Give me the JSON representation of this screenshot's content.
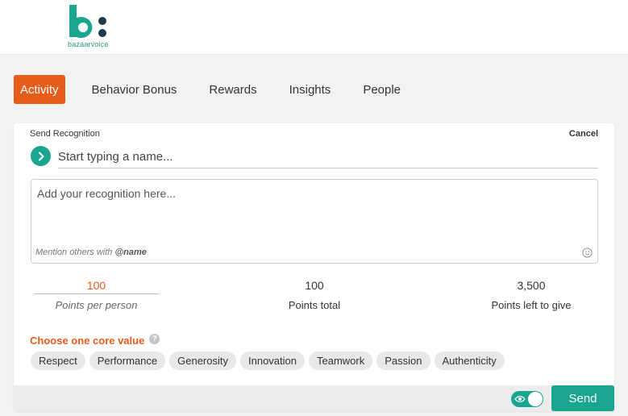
{
  "brand": {
    "logo_text": "bazaarvoice",
    "logo_color": "#1aa591"
  },
  "tabs": [
    {
      "label": "Activity",
      "active": true
    },
    {
      "label": "Behavior Bonus",
      "active": false
    },
    {
      "label": "Rewards",
      "active": false
    },
    {
      "label": "Insights",
      "active": false
    },
    {
      "label": "People",
      "active": false
    }
  ],
  "form": {
    "title": "Send Recognition",
    "cancel_label": "Cancel",
    "name_placeholder": "Start typing a name...",
    "recognition_placeholder": "Add your recognition here...",
    "mention_prefix": "Mention others with ",
    "mention_handle": "@name",
    "points": {
      "per_person_value": "100",
      "per_person_label": "Points per person",
      "total_value": "100",
      "total_label": "Points total",
      "left_value": "3,500",
      "left_label": "Points left to give"
    },
    "core_value_title": "Choose one core value",
    "core_values": [
      "Respect",
      "Performance",
      "Generosity",
      "Innovation",
      "Teamwork",
      "Passion",
      "Authenticity"
    ],
    "send_label": "Send",
    "visibility_toggle_on": true
  },
  "colors": {
    "accent_orange": "#e85c1b",
    "accent_teal": "#1aa591"
  },
  "icons": [
    "arrow-right-icon",
    "smiley-icon",
    "help-icon",
    "eye-icon"
  ]
}
